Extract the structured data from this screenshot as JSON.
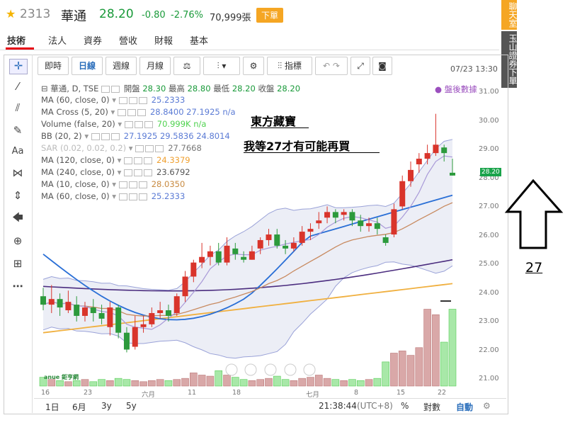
{
  "header": {
    "code": "2313",
    "name": "華通",
    "price": "28.20",
    "change": "-0.80",
    "pct": "-2.76%",
    "volume": "70,999張",
    "order_btn": "下單"
  },
  "tabs": [
    {
      "label": "技術"
    },
    {
      "label": "法人"
    },
    {
      "label": "資券"
    },
    {
      "label": "營收"
    },
    {
      "label": "財報"
    },
    {
      "label": "基本"
    }
  ],
  "datetime": "07/23 13:30",
  "right": {
    "chat": "聊天室",
    "broker": "玉山證券下單"
  },
  "toolbar": {
    "tick": "即時",
    "day": "日線",
    "week": "週線",
    "month": "月線",
    "indicator": "指標"
  },
  "legend": {
    "main": "華通, D, TSE",
    "ohlc": [
      "開盤",
      "28.30",
      "最高",
      "28.80",
      "最低",
      "28.20",
      "收盤",
      "28.20"
    ],
    "rows": [
      {
        "label": "MA (60, close, 0)",
        "value": "25.2333",
        "color": "#5b7bd5"
      },
      {
        "label": "MA Cross (5, 20)",
        "value": "28.8400 27.1925 n/a",
        "color": "#5b7bd5"
      },
      {
        "label": "Volume (false, 20)",
        "value": "70.999K n/a",
        "color": "#4fd24f"
      },
      {
        "label": "BB (20, 2)",
        "value": "27.1925 29.5836 24.8014",
        "color": "#5b7bd5"
      },
      {
        "label": "SAR (0.02, 0.02, 0.2)",
        "value": "27.7668",
        "color": "#777"
      },
      {
        "label": "MA (120, close, 0)",
        "value": "24.3379",
        "color": "#f0a030"
      },
      {
        "label": "MA (240, close, 0)",
        "value": "23.6792",
        "color": "#555"
      },
      {
        "label": "MA (10, close, 0)",
        "value": "28.0350",
        "color": "#c88a40"
      },
      {
        "label": "MA (60, close, 0)",
        "value": "25.2333",
        "color": "#5b7bd5"
      }
    ],
    "after_hours": "● 盤後數據"
  },
  "annotation": {
    "line1": "東方藏寶",
    "line2": "我等27才有可能再買",
    "arrow_label": "27"
  },
  "yaxis": [
    "31.00",
    "30.00",
    "29.00",
    "28.00",
    "27.00",
    "26.00",
    "25.00",
    "24.00",
    "23.00",
    "22.00",
    "21.00"
  ],
  "price_tag": "28.20",
  "xaxis": [
    "16",
    "23",
    "六月",
    "11",
    "18",
    "七月",
    "8",
    "15",
    "22"
  ],
  "bottom": {
    "r1": "1日",
    "r2": "6月",
    "r3": "3y",
    "r4": "5y",
    "time": "21:38:44",
    "tz": "(UTC+8)",
    "pct": "%",
    "log": "對數",
    "auto": "自動"
  },
  "watermark": "anue 鉅亨網",
  "chart_data": {
    "type": "candlestick",
    "ylim": [
      20.7,
      31.3
    ],
    "candles": [
      [
        23.9,
        23.6,
        24.2,
        23.4
      ],
      [
        23.6,
        23.8,
        24.3,
        23.3
      ],
      [
        23.8,
        23.5,
        24.0,
        23.2
      ],
      [
        23.4,
        23.7,
        24.1,
        23.3
      ],
      [
        23.6,
        23.2,
        23.9,
        23.0
      ],
      [
        23.2,
        23.5,
        23.7,
        23.0
      ],
      [
        23.5,
        23.3,
        23.8,
        23.0
      ],
      [
        23.3,
        23.1,
        23.6,
        22.9
      ],
      [
        22.8,
        23.5,
        23.7,
        22.5
      ],
      [
        23.5,
        22.6,
        23.6,
        22.4
      ],
      [
        22.6,
        22.0,
        22.8,
        21.9
      ],
      [
        22.1,
        22.8,
        23.2,
        22.0
      ],
      [
        22.8,
        22.9,
        23.2,
        22.6
      ],
      [
        22.9,
        23.3,
        23.5,
        22.8
      ],
      [
        23.3,
        23.4,
        23.7,
        23.1
      ],
      [
        23.4,
        23.2,
        23.6,
        23.0
      ],
      [
        23.3,
        23.9,
        24.0,
        23.2
      ],
      [
        23.9,
        24.6,
        24.8,
        23.7
      ],
      [
        24.6,
        25.1,
        25.2,
        24.4
      ],
      [
        25.1,
        25.3,
        25.8,
        24.9
      ],
      [
        25.3,
        25.5,
        25.7,
        25.0
      ],
      [
        25.5,
        25.1,
        25.8,
        25.0
      ],
      [
        25.1,
        25.7,
        26.0,
        25.0
      ],
      [
        25.6,
        25.4,
        25.8,
        25.2
      ],
      [
        25.3,
        25.2,
        25.5,
        25.1
      ],
      [
        25.2,
        25.5,
        25.7,
        25.2
      ],
      [
        25.6,
        25.9,
        26.0,
        25.4
      ],
      [
        25.9,
        26.1,
        26.3,
        25.7
      ],
      [
        26.1,
        25.7,
        26.3,
        25.6
      ],
      [
        25.7,
        25.6,
        25.9,
        25.4
      ],
      [
        25.6,
        25.8,
        26.0,
        25.5
      ],
      [
        25.8,
        26.2,
        26.4,
        25.7
      ],
      [
        26.2,
        26.3,
        26.5,
        25.9
      ],
      [
        26.5,
        26.6,
        26.9,
        26.3
      ],
      [
        26.7,
        26.9,
        27.1,
        26.5
      ],
      [
        26.9,
        26.7,
        27.0,
        26.5
      ],
      [
        26.8,
        26.9,
        27.0,
        26.6
      ],
      [
        26.9,
        26.6,
        27.0,
        26.4
      ],
      [
        26.6,
        26.4,
        26.8,
        26.2
      ],
      [
        26.4,
        26.5,
        26.7,
        26.2
      ],
      [
        26.5,
        26.3,
        26.7,
        26.1
      ],
      [
        26.0,
        25.8,
        26.1,
        25.7
      ],
      [
        26.1,
        27.0,
        27.2,
        26.0
      ],
      [
        27.1,
        28.0,
        28.2,
        27.0
      ],
      [
        28.0,
        28.4,
        28.7,
        27.8
      ],
      [
        28.6,
        28.8,
        29.0,
        28.3
      ],
      [
        28.8,
        29.0,
        29.3,
        28.6
      ],
      [
        29.0,
        29.3,
        30.4,
        28.9
      ],
      [
        29.2,
        29.0,
        29.3,
        28.7
      ],
      [
        28.3,
        28.2,
        28.8,
        28.2
      ]
    ],
    "volumes": [
      8,
      6,
      5,
      4,
      5,
      6,
      4,
      6,
      5,
      7,
      6,
      5,
      4,
      5,
      6,
      5,
      6,
      7,
      12,
      10,
      9,
      14,
      10,
      8,
      6,
      5,
      6,
      7,
      9,
      6,
      5,
      7,
      8,
      10,
      7,
      6,
      5,
      6,
      5,
      6,
      7,
      22,
      30,
      32,
      28,
      35,
      70,
      65,
      40,
      70
    ]
  }
}
